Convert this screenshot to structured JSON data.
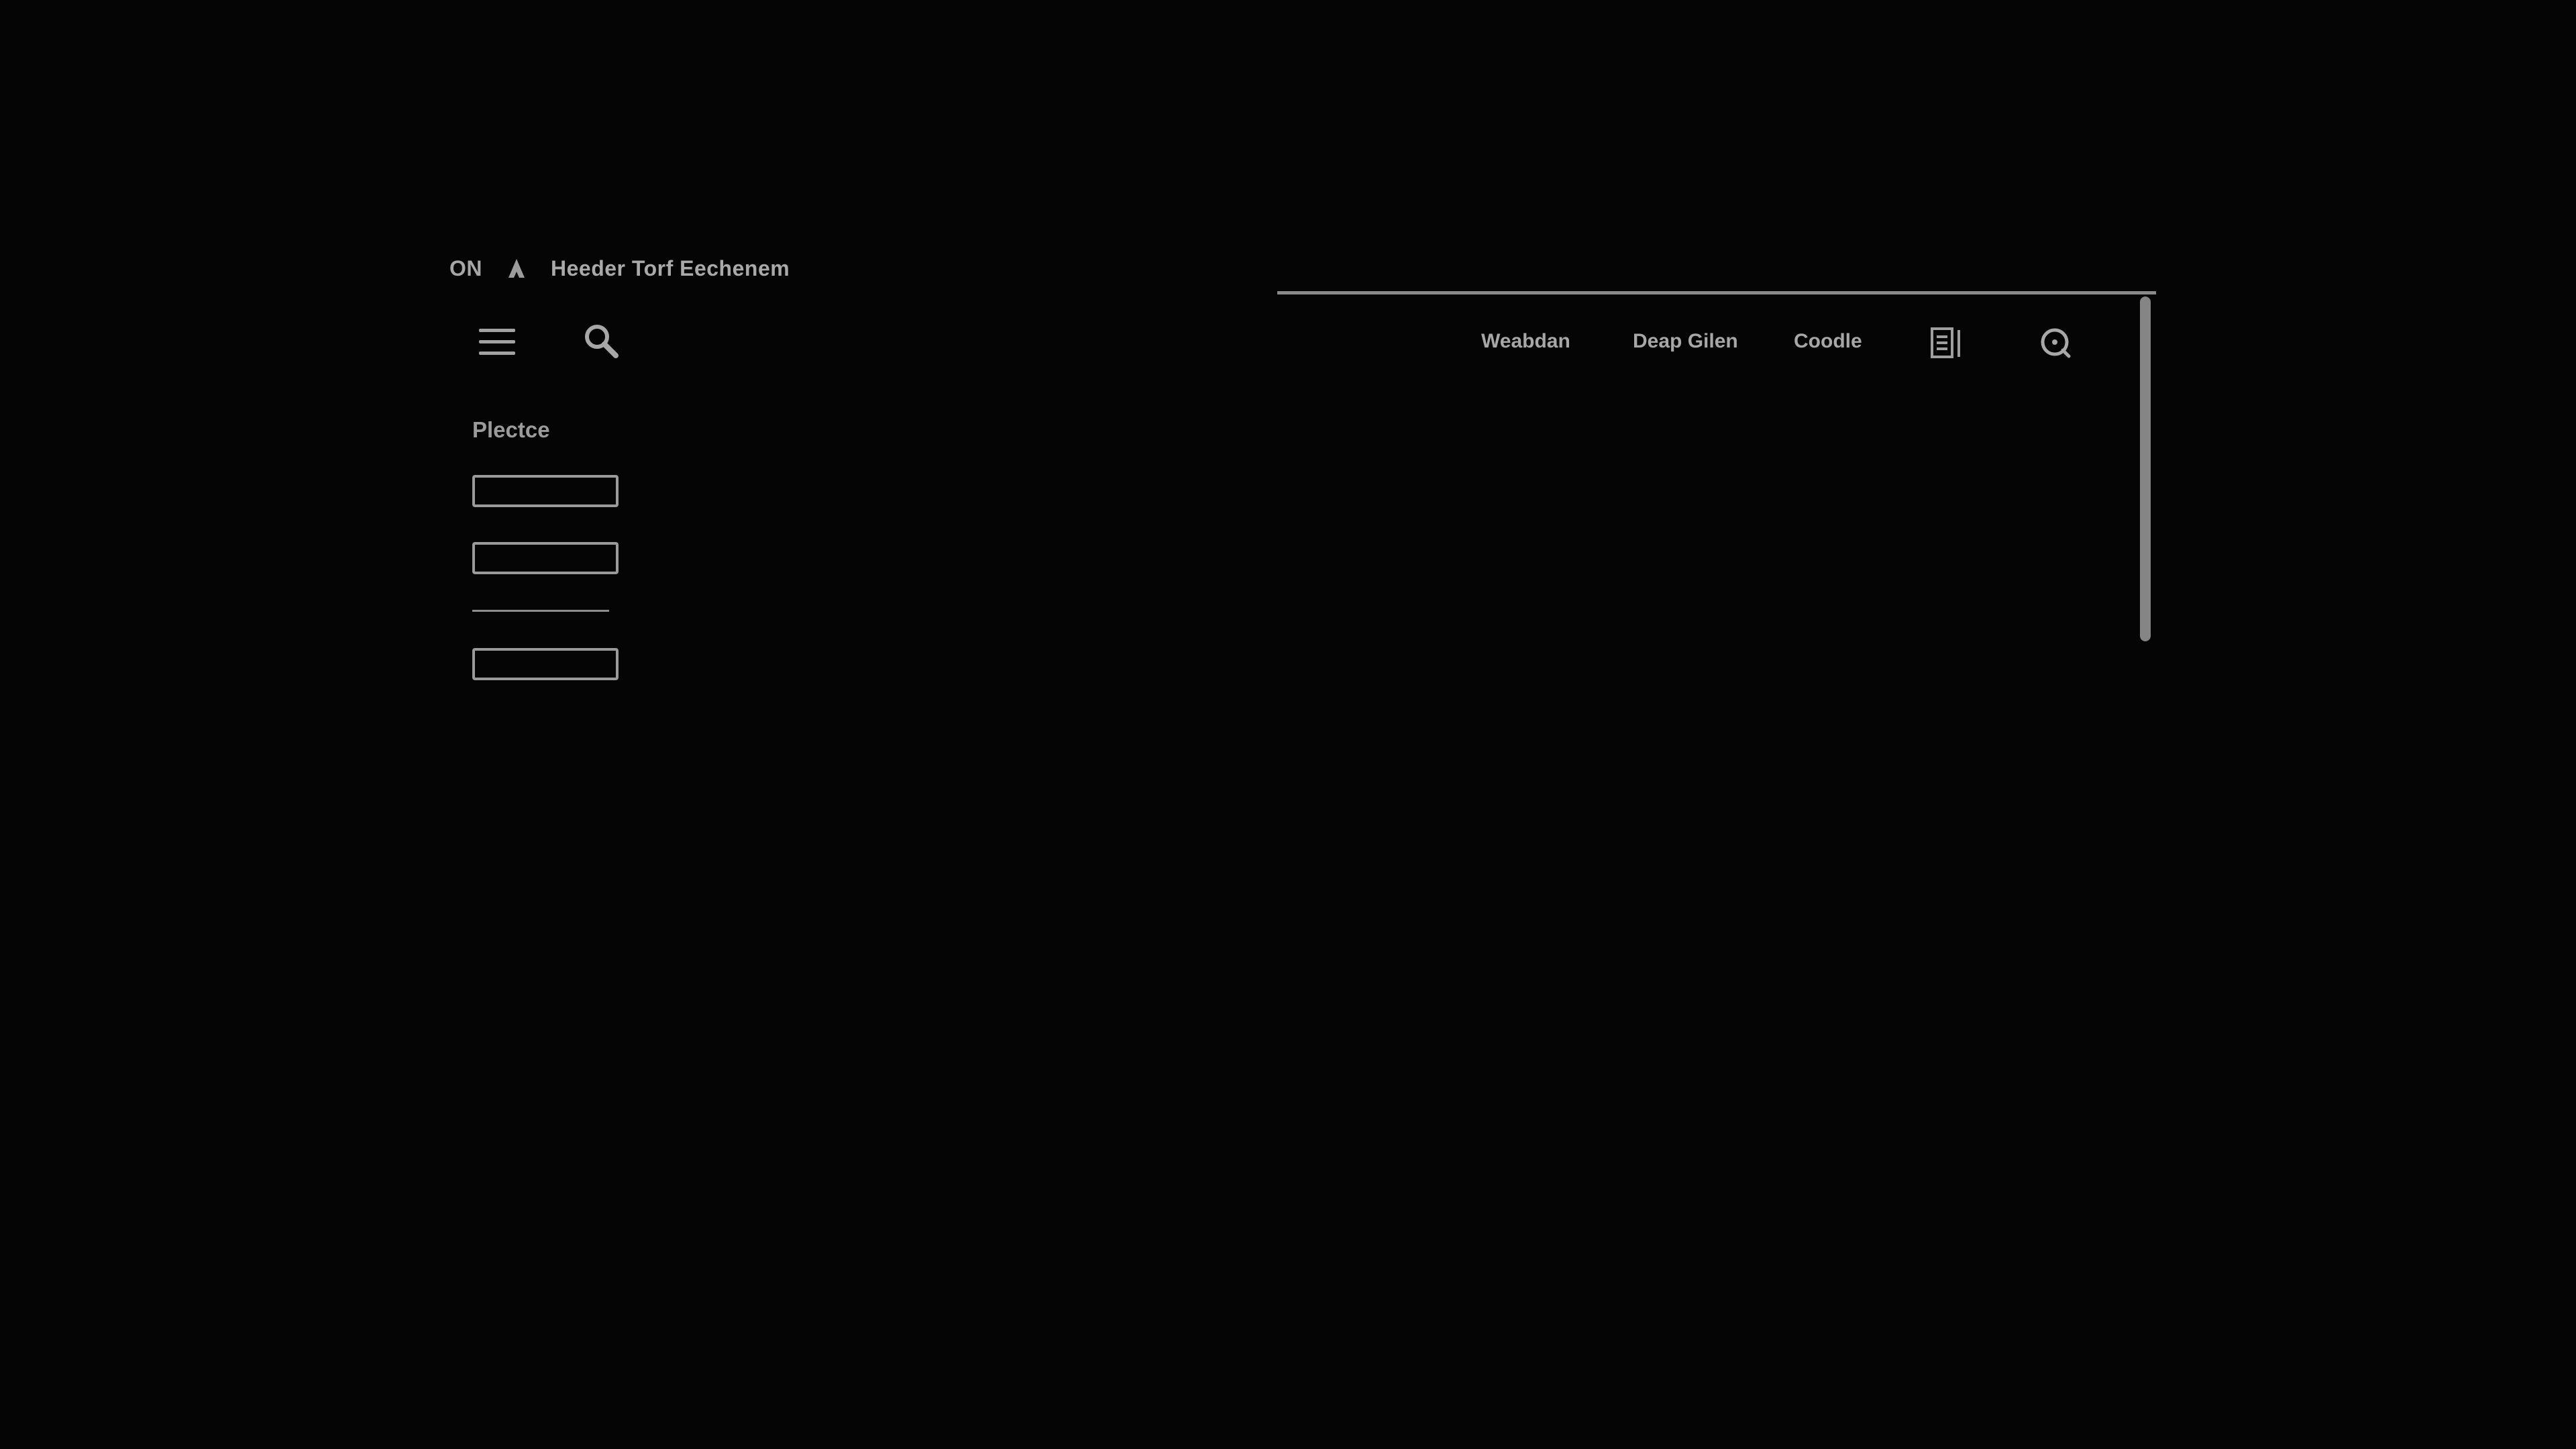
{
  "status_bar": {
    "status_text": "ON",
    "home_icon": "home-icon",
    "title": "Heeder Torf Eechenem"
  },
  "toolbar": {
    "menu_icon": "menu-icon",
    "search_icon": "search-icon"
  },
  "left_panel": {
    "label": "Plectce",
    "fields": [
      {
        "value": "",
        "placeholder": ""
      },
      {
        "value": "",
        "placeholder": ""
      },
      {
        "value": "",
        "placeholder": ""
      }
    ]
  },
  "right_nav": {
    "items": [
      {
        "label": "Weabdan"
      },
      {
        "label": "Deap Gilen"
      },
      {
        "label": "Coodle"
      }
    ],
    "icons": [
      "document-list-icon",
      "search-circle-icon"
    ]
  },
  "colors": {
    "background": "#050505",
    "foreground": "#a7a7a7",
    "line": "#8a8a8a"
  }
}
